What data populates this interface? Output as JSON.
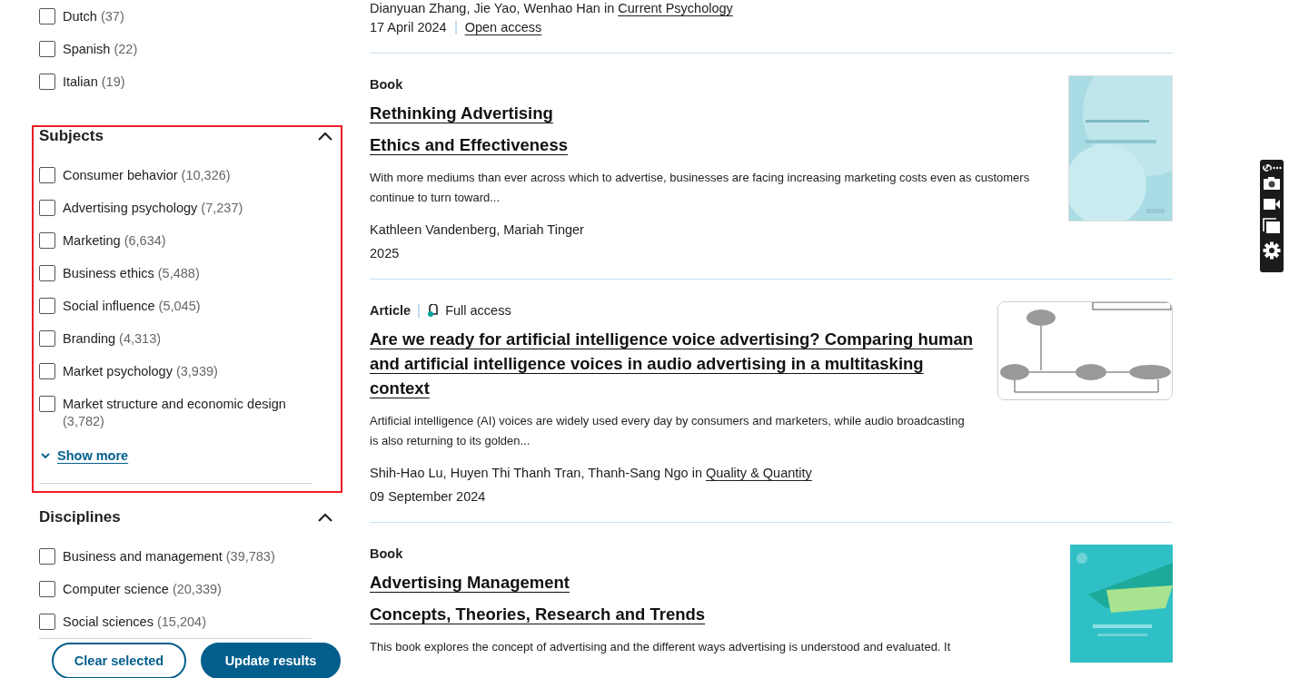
{
  "sidebar": {
    "language_options": [
      {
        "label": "Dutch",
        "count": "(37)",
        "checked": false
      },
      {
        "label": "Spanish",
        "count": "(22)",
        "checked": false
      },
      {
        "label": "Italian",
        "count": "(19)",
        "checked": false
      }
    ],
    "subjects": {
      "title": "Subjects",
      "expanded": true,
      "highlighted": true,
      "show_more": "Show more",
      "options": [
        {
          "label": "Consumer behavior",
          "count": "(10,326)",
          "checked": false
        },
        {
          "label": "Advertising psychology",
          "count": "(7,237)",
          "checked": false
        },
        {
          "label": "Marketing",
          "count": "(6,634)",
          "checked": false
        },
        {
          "label": "Business ethics",
          "count": "(5,488)",
          "checked": false
        },
        {
          "label": "Social influence",
          "count": "(5,045)",
          "checked": false
        },
        {
          "label": "Branding",
          "count": "(4,313)",
          "checked": false
        },
        {
          "label": "Market psychology",
          "count": "(3,939)",
          "checked": false
        },
        {
          "label": "Market structure and economic design",
          "count": "(3,782)",
          "checked": false
        }
      ]
    },
    "disciplines": {
      "title": "Disciplines",
      "expanded": true,
      "options": [
        {
          "label": "Business and management",
          "count": "(39,783)",
          "checked": false
        },
        {
          "label": "Computer science",
          "count": "(20,339)",
          "checked": false
        },
        {
          "label": "Social sciences",
          "count": "(15,204)",
          "checked": false
        }
      ]
    },
    "buttons": [
      {
        "label": "Clear selected",
        "kind": "secondary"
      },
      {
        "label": "Update results",
        "kind": "primary"
      }
    ]
  },
  "results": {
    "previous_tail": {
      "byline": "Dianyuan Zhang, Jie Yao, Wenhao Han in",
      "journal": "Current Psychology",
      "date": "17 April 2024",
      "access": "Open access"
    },
    "items": [
      {
        "type": "Book",
        "title": "Rethinking Advertising",
        "subtitle": "Ethics and Effectiveness",
        "snippet": "With more mediums than ever across which to advertise, businesses are facing increasing marketing costs even as customers continue to turn toward...",
        "byline": "Kathleen Vandenberg, Mariah Tinger",
        "date": "2025"
      },
      {
        "type": "Article",
        "access": "Full access",
        "title": "Are we ready for artificial intelligence voice advertising? Comparing human and artificial intelligence voices in audio advertising in a multitasking context",
        "snippet": "Artificial intelligence (AI) voices are widely used every day by consumers and marketers, while audio broadcasting is also returning to its golden...",
        "byline": "Shih-Hao Lu, Huyen Thi Thanh Tran, Thanh-Sang Ngo in",
        "journal": "Quality & Quantity",
        "date": "09 September 2024"
      },
      {
        "type": "Book",
        "title": "Advertising Management",
        "subtitle": "Concepts, Theories, Research and Trends",
        "snippet": "This book explores the concept of advertising and the different ways advertising is understood and evaluated. It"
      }
    ]
  }
}
